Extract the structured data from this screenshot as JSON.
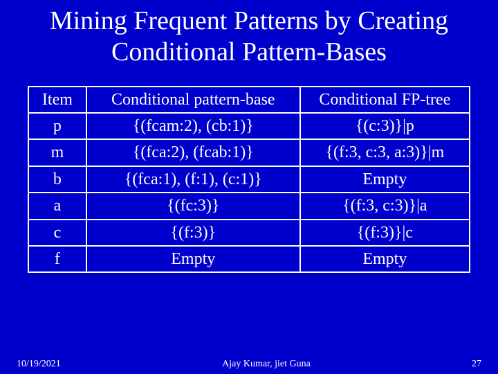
{
  "title": "Mining Frequent Patterns by Creating Conditional Pattern-Bases",
  "table": {
    "headers": [
      "Item",
      "Conditional pattern-base",
      "Conditional FP-tree"
    ],
    "rows": [
      {
        "item": "p",
        "base": "{(fcam:2), (cb:1)}",
        "tree": "{(c:3)}|p"
      },
      {
        "item": "m",
        "base": "{(fca:2), (fcab:1)}",
        "tree": "{(f:3, c:3, a:3)}|m"
      },
      {
        "item": "b",
        "base": "{(fca:1), (f:1), (c:1)}",
        "tree": "Empty"
      },
      {
        "item": "a",
        "base": "{(fc:3)}",
        "tree": "{(f:3, c:3)}|a"
      },
      {
        "item": "c",
        "base": "{(f:3)}",
        "tree": "{(f:3)}|c"
      },
      {
        "item": "f",
        "base": "Empty",
        "tree": "Empty"
      }
    ]
  },
  "footer": {
    "date": "10/19/2021",
    "author": "Ajay Kumar, jiet Guna",
    "page": "27"
  }
}
